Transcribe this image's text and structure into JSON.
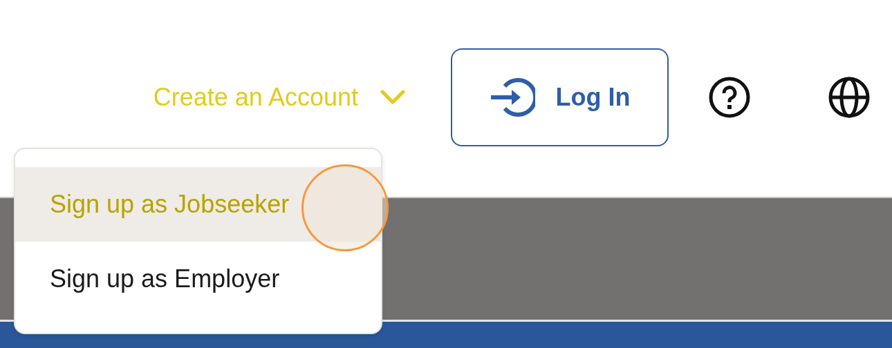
{
  "header": {
    "create_account": {
      "label": "Create an Account",
      "expanded": true
    },
    "login_button": {
      "label": "Log In"
    },
    "account_menu": [
      {
        "label": "Sign up as Jobseeker",
        "selected": true
      },
      {
        "label": "Sign up as Employer",
        "selected": false
      }
    ]
  }
}
